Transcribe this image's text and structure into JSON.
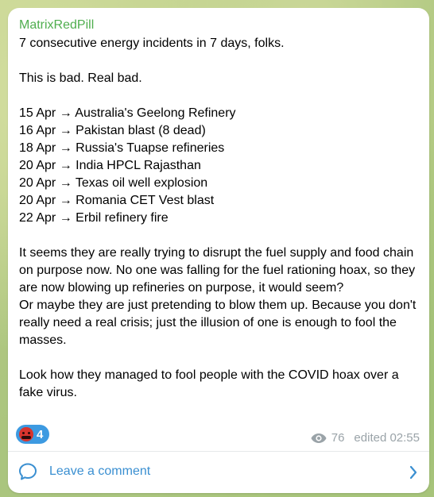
{
  "post": {
    "channel": "MatrixRedPill",
    "lines": [
      "7 consecutive energy incidents in 7 days, folks.",
      "",
      "This is bad. Real bad.",
      "",
      "15 Apr → Australia's Geelong Refinery",
      "16 Apr → Pakistan blast (8 dead)",
      "18 Apr → Russia's Tuapse refineries",
      "20 Apr → India HPCL Rajasthan",
      "20 Apr → Texas oil well explosion",
      "20 Apr → Romania CET Vest blast",
      "22 Apr → Erbil refinery fire",
      "",
      "It seems they are really trying to disrupt the fuel supply and food chain on purpose now. No one was falling for the fuel rationing hoax, so they are now blowing up refineries on purpose, it would seem?",
      "Or maybe they are just pretending to blow them up. Because you don't really need a real crisis; just the illusion of one is enough to fool the masses.",
      "",
      "Look how they managed to fool people with the COVID hoax over a fake virus."
    ]
  },
  "reaction": {
    "emoji": "angry-face-icon",
    "count": "4"
  },
  "meta": {
    "views": "76",
    "edited": "edited 02:55"
  },
  "comments": {
    "label": "Leave a comment"
  },
  "colors": {
    "sender": "#4fae4e",
    "link": "#3a8fd1",
    "reaction_bg": "#3d9ae1"
  }
}
